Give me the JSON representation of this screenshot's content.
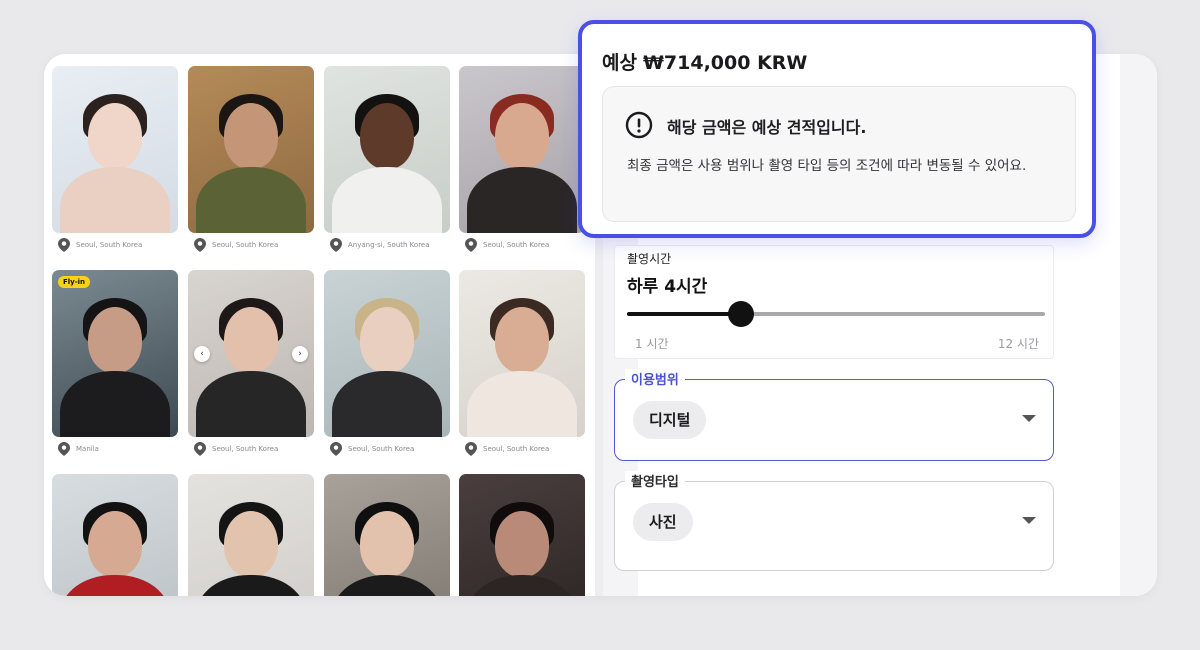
{
  "gallery": {
    "models": [
      {
        "location": "Seoul, South Korea"
      },
      {
        "location": "Seoul, South Korea"
      },
      {
        "location": "Anyang-si, South Korea"
      },
      {
        "location": "Seoul, South Korea"
      },
      {
        "location": "Manila",
        "badge": "Fly-in"
      },
      {
        "location": "Seoul, South Korea"
      },
      {
        "location": "Seoul, South Korea"
      },
      {
        "location": "Seoul, South Korea"
      },
      {
        "location": ""
      },
      {
        "location": ""
      },
      {
        "location": ""
      },
      {
        "location": ""
      }
    ],
    "carousel_prev": "‹",
    "carousel_next": "›"
  },
  "estimate": {
    "label": "예상",
    "amount": "₩714,000 KRW",
    "notice_title": "해당 금액은 예상 견적입니다.",
    "notice_body": "최종 금액은 사용 범위나 촬영 타입 등의 조건에 따라 변동될 수 있어요.",
    "accent_color": "#4a4fe6"
  },
  "duration": {
    "label": "촬영시간",
    "value": "하루 4시간",
    "min_label": "1 시간",
    "max_label": "12 시간",
    "min": 1,
    "max": 12,
    "current": 4
  },
  "usage": {
    "label": "이용범위",
    "selected": "디지털"
  },
  "shoot_type": {
    "label": "촬영타입",
    "selected": "사진"
  },
  "icons": {
    "location": "map-pin-icon",
    "warning": "exclamation-circle-icon",
    "dropdown": "caret-down-icon"
  }
}
